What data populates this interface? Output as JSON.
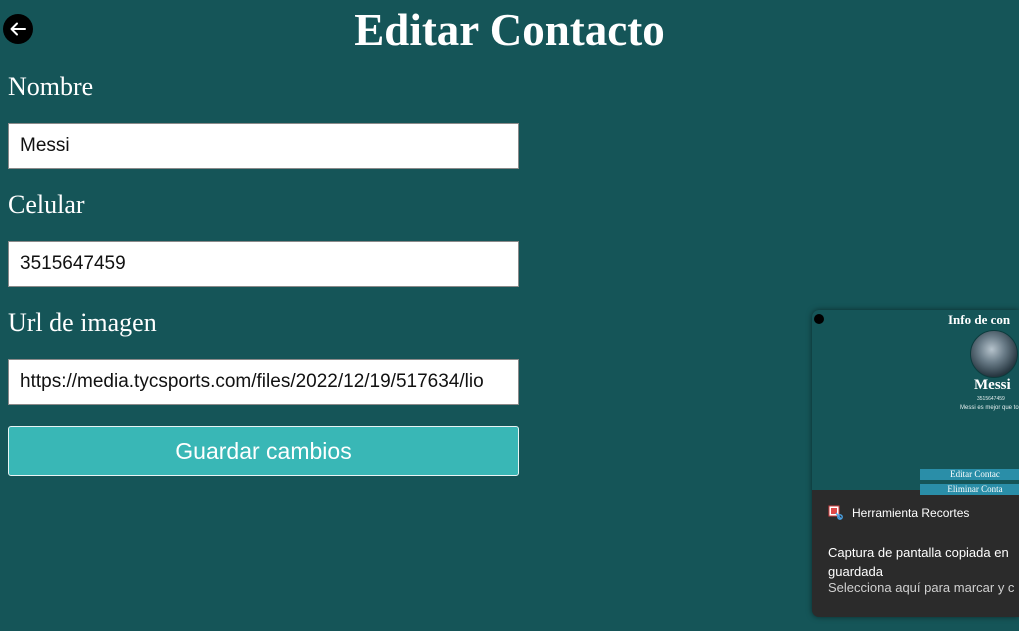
{
  "page": {
    "title": "Editar Contacto",
    "back_icon": "arrow-left-icon"
  },
  "form": {
    "nombre_label": "Nombre",
    "nombre_value": "Messi",
    "celular_label": "Celular",
    "celular_value": "3515647459",
    "url_label": "Url de imagen",
    "url_value": "https://media.tycsports.com/files/2022/12/19/517634/lio",
    "save_label": "Guardar cambios"
  },
  "colors": {
    "background": "#155558",
    "button": "#39b7b6"
  },
  "toast": {
    "preview": {
      "title": "Info de con",
      "name": "Messi",
      "phone": "3515647459",
      "description": "Messi es mejor que to",
      "edit_button": "Editar Contac",
      "delete_button": "Eliminar Conta"
    },
    "app_name": "Herramienta Recortes",
    "app_icon": "snipping-tool-icon",
    "message_line1": "Captura de pantalla copiada en",
    "message_line2": "guardada",
    "sub_message": "Selecciona aquí para marcar y c"
  }
}
